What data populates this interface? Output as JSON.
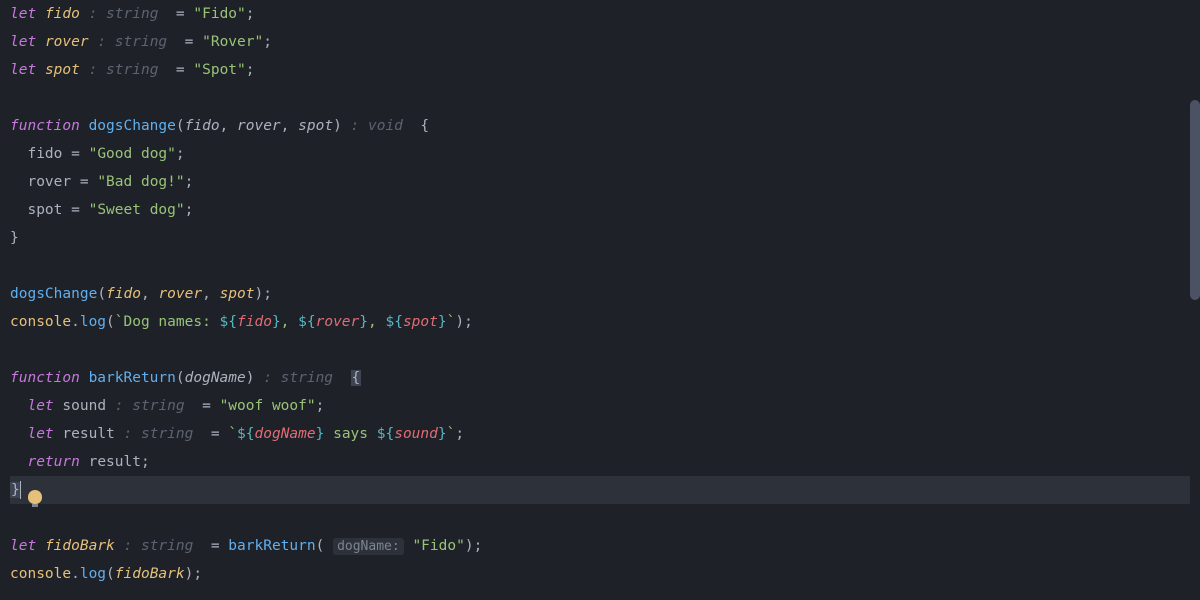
{
  "code": {
    "let": "let",
    "function": "function",
    "return": "return",
    "fido": "fido",
    "rover": "rover",
    "spot": "spot",
    "sound": "sound",
    "result": "result",
    "fidoBark": "fidoBark",
    "dogName": "dogName",
    "typeString": ": string",
    "typeVoid": ": void",
    "eq": " = ",
    "eqShort": "= ",
    "strFido": "\"Fido\"",
    "strRover": "\"Rover\"",
    "strSpot": "\"Spot\"",
    "strGoodDog": "\"Good dog\"",
    "strBadDog": "\"Bad dog!\"",
    "strSweetDog": "\"Sweet dog\"",
    "strWoof": "\"woof woof\"",
    "semi": ";",
    "dogsChange": "dogsChange",
    "barkReturn": "barkReturn",
    "openParen": "(",
    "closeParen": ")",
    "openBrace": "{",
    "closeBrace": "}",
    "comma": ", ",
    "console": "console",
    "dot": ".",
    "log": "log",
    "tmplStart": "`Dog names: ",
    "tmplOpen": "${",
    "tmplClose": "}",
    "tmplCommaSp": ", ",
    "tmplEnd": "`",
    "tmplSays": " says ",
    "paramHintDogName": "dogName:",
    "space": " ",
    "indent": "  "
  }
}
